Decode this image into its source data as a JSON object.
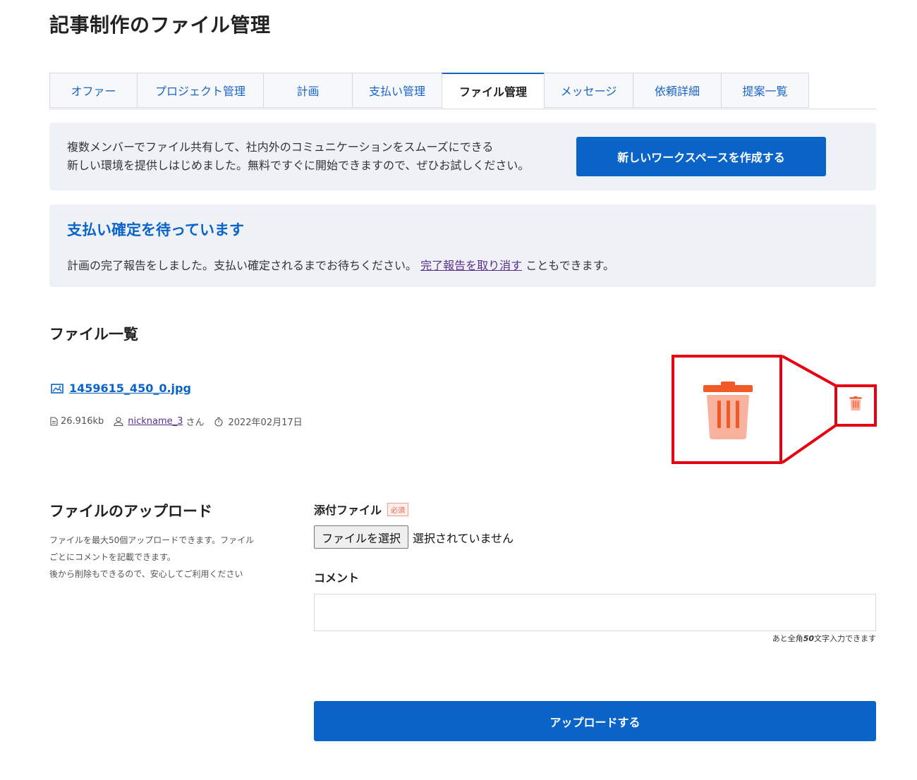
{
  "page": {
    "title": "記事制作のファイル管理"
  },
  "tabs": [
    {
      "label": "オファー",
      "active": false
    },
    {
      "label": "プロジェクト管理",
      "active": false
    },
    {
      "label": "計画",
      "active": false
    },
    {
      "label": "支払い管理",
      "active": false
    },
    {
      "label": "ファイル管理",
      "active": true
    },
    {
      "label": "メッセージ",
      "active": false
    },
    {
      "label": "依頼詳細",
      "active": false
    },
    {
      "label": "提案一覧",
      "active": false
    }
  ],
  "promo": {
    "line1": "複数メンバーでファイル共有して、社内外のコミュニケーションをスムーズにできる",
    "line2": "新しい環境を提供しはじめました。無料ですぐに開始できますので、ぜひお試しください。",
    "button_label": "新しいワークスペースを作成する"
  },
  "notice": {
    "title": "支払い確定を待っています",
    "body_before": "計画の完了報告をしました。支払い確定されるまでお待ちください。",
    "link_text": "完了報告を取り消す",
    "body_after": "こともできます。"
  },
  "file_list": {
    "title": "ファイル一覧",
    "file": {
      "name": "1459615_450_0.jpg",
      "size": "26.916kb",
      "user": "nickname_3",
      "user_suffix": "さん",
      "date": "2022年02月17日"
    },
    "icons": {
      "file": "image-icon",
      "size": "document-icon",
      "user": "user-icon",
      "date": "clock-icon",
      "delete": "trash-icon"
    }
  },
  "upload": {
    "title": "ファイルのアップロード",
    "desc_line1": "ファイルを最大50個アップロードできます。ファイル",
    "desc_line2": "ごとにコメントを記載できます。",
    "desc_line3": "後から削除もできるので、安心してご利用ください",
    "attach_label": "添付ファイル",
    "required_label": "必須",
    "choose_button": "ファイルを選択",
    "no_file": "選択されていません",
    "comment_label": "コメント",
    "comment_value": "",
    "char_count_prefix": "あと全角",
    "char_count_number": "50",
    "char_count_suffix": "文字入力できます",
    "submit_label": "アップロードする"
  },
  "colors": {
    "primary": "#0a64c8",
    "highlight": "#e60012",
    "trash_lid": "#f05a28",
    "trash_body": "#f9b29d"
  }
}
